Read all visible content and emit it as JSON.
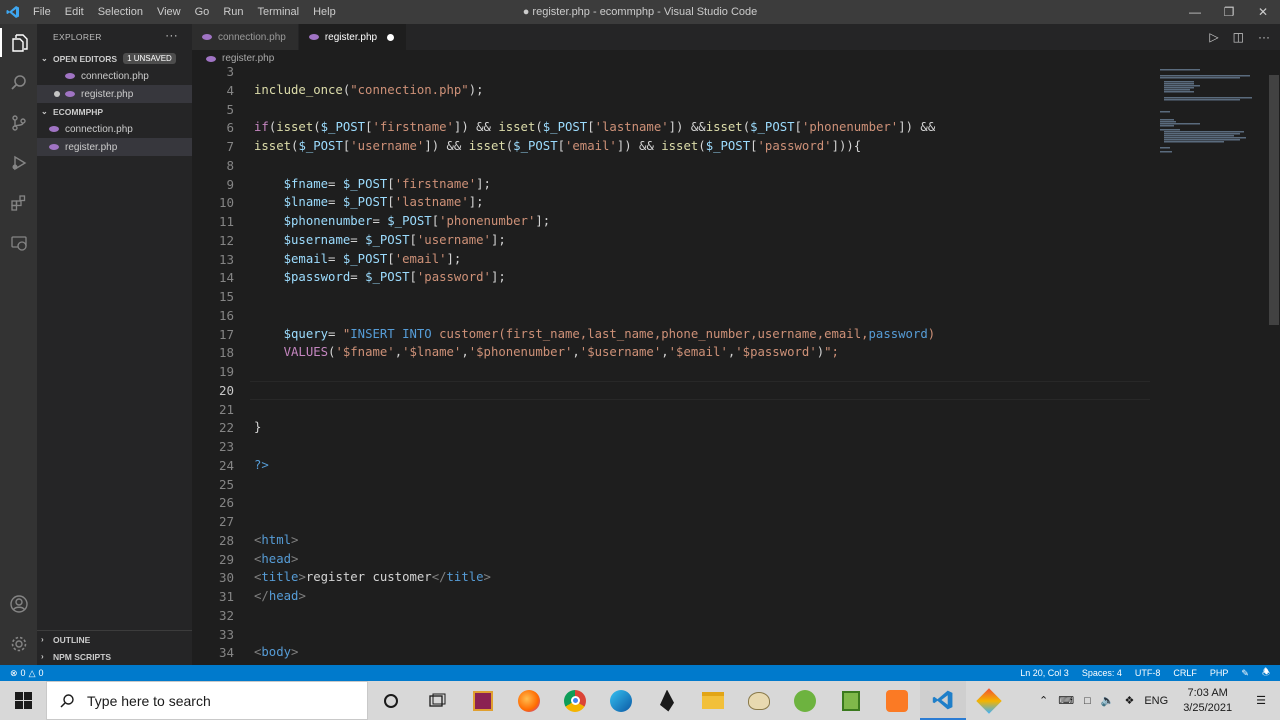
{
  "titlebar": {
    "title": "● register.php - ecommphp - Visual Studio Code",
    "menu": [
      "File",
      "Edit",
      "Selection",
      "View",
      "Go",
      "Run",
      "Terminal",
      "Help"
    ]
  },
  "sidebar": {
    "header": "EXPLORER",
    "open_editors": {
      "label": "OPEN EDITORS",
      "badge": "1 UNSAVED",
      "files": [
        "connection.php",
        "register.php"
      ]
    },
    "folder": {
      "label": "ECOMMPHP",
      "files": [
        "connection.php",
        "register.php"
      ]
    },
    "outline_label": "OUTLINE",
    "npm_label": "NPM SCRIPTS"
  },
  "tabs": [
    {
      "label": "connection.php",
      "active": false
    },
    {
      "label": "register.php",
      "active": true,
      "modified": true
    }
  ],
  "breadcrumb": "register.php",
  "editor": {
    "current_line": 20,
    "lines": [
      {
        "n": 3,
        "code": ""
      },
      {
        "n": 4,
        "code": "include_once(\"connection.php\");"
      },
      {
        "n": 5,
        "code": ""
      },
      {
        "n": 6,
        "code": "if(isset($_POST['firstname']) && isset($_POST['lastname']) &&isset($_POST['phonenumber']) &&"
      },
      {
        "n": 7,
        "code": "isset($_POST['username']) && isset($_POST['email']) && isset($_POST['password'])){"
      },
      {
        "n": 8,
        "code": ""
      },
      {
        "n": 9,
        "code": "    $fname= $_POST['firstname'];"
      },
      {
        "n": 10,
        "code": "    $lname= $_POST['lastname'];"
      },
      {
        "n": 11,
        "code": "    $phonenumber= $_POST['phonenumber'];"
      },
      {
        "n": 12,
        "code": "    $username= $_POST['username'];"
      },
      {
        "n": 13,
        "code": "    $email= $_POST['email'];"
      },
      {
        "n": 14,
        "code": "    $password= $_POST['password'];"
      },
      {
        "n": 15,
        "code": ""
      },
      {
        "n": 16,
        "code": ""
      },
      {
        "n": 17,
        "code": "    $query= \"INSERT INTO customer(first_name,last_name,phone_number,username,email,password)"
      },
      {
        "n": 18,
        "code": "    VALUES('$fname','$lname','$phonenumber','$username','$email','$password')\";"
      },
      {
        "n": 19,
        "code": ""
      },
      {
        "n": 20,
        "code": ""
      },
      {
        "n": 21,
        "code": ""
      },
      {
        "n": 22,
        "code": "}"
      },
      {
        "n": 23,
        "code": ""
      },
      {
        "n": 24,
        "code": "?>"
      },
      {
        "n": 25,
        "code": ""
      },
      {
        "n": 26,
        "code": ""
      },
      {
        "n": 27,
        "code": ""
      },
      {
        "n": 28,
        "code": "<html>"
      },
      {
        "n": 29,
        "code": "<head>"
      },
      {
        "n": 30,
        "code": "<title>register customer</title>"
      },
      {
        "n": 31,
        "code": "</head>"
      },
      {
        "n": 32,
        "code": ""
      },
      {
        "n": 33,
        "code": ""
      },
      {
        "n": 34,
        "code": "<body>"
      }
    ]
  },
  "statusbar": {
    "errors": "0",
    "warnings": "0",
    "position": "Ln 20, Col 3",
    "spaces": "Spaces: 4",
    "encoding": "UTF-8",
    "eol": "CRLF",
    "language": "PHP"
  },
  "taskbar": {
    "search_placeholder": "Type here to search",
    "language": "ENG",
    "time": "7:03 AM",
    "date": "3/25/2021"
  },
  "colors": {
    "accent": "#007acc",
    "keyword": "#569cd6",
    "variable": "#9cdcfe",
    "string": "#ce9178",
    "function": "#dcdcaa"
  }
}
